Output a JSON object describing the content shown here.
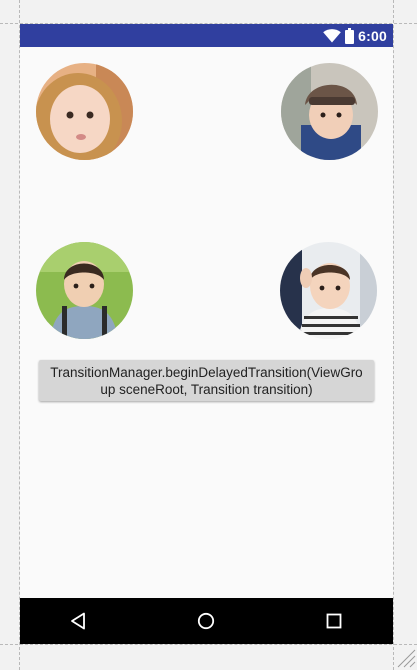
{
  "status_bar": {
    "time": "6:00",
    "background": "#303f9f",
    "icons": [
      "wifi-icon",
      "battery-icon"
    ]
  },
  "main": {
    "images": [
      {
        "name": "child-face-top-left",
        "description_icon": "avatar-image"
      },
      {
        "name": "child-cap-top-right",
        "description_icon": "avatar-image"
      },
      {
        "name": "child-backpack-middle-left",
        "description_icon": "avatar-image"
      },
      {
        "name": "child-striped-middle-right",
        "description_icon": "avatar-image"
      }
    ],
    "button_label": "TransitionManager.beginDelayedTransition(ViewGroup sceneRoot, Transition transition)"
  },
  "nav_bar": {
    "buttons": [
      "back-icon",
      "home-icon",
      "recents-icon"
    ],
    "background": "#000000"
  }
}
